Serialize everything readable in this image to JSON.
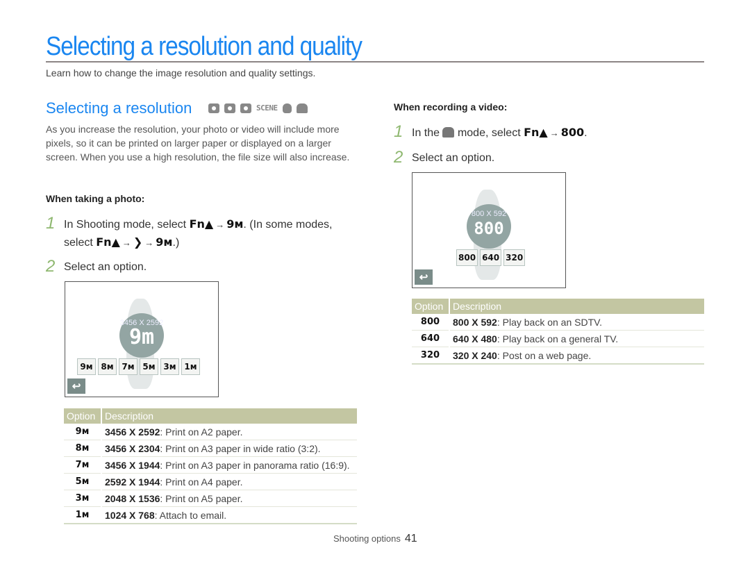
{
  "page": {
    "title": "Selecting a resolution and quality",
    "subtitle": "Learn how to change the image resolution and quality settings.",
    "section_title": "Selecting a resolution",
    "mode_icons": [
      "smart-auto-icon",
      "camera-auto-icon",
      "program-icon",
      "SCENE",
      "dual-is-icon",
      "movie-icon"
    ],
    "intro": "As you increase the resolution, your photo or video will include more pixels, so it can be printed on larger paper or displayed on a larger screen. When you use a high resolution, the file size will also increase."
  },
  "photo": {
    "heading": "When taking a photo:",
    "step1": {
      "num": "1",
      "text_a": "In Shooting mode, select",
      "key_fn": "Fn▲",
      "arrow": "→",
      "key_res": "9м",
      "text_b": ". (In some modes,",
      "text_c": "select",
      "key_next": "❯",
      "text_d": ".)"
    },
    "step2": {
      "num": "2",
      "text": "Select an option."
    },
    "screen": {
      "resolution_label": "3456 X 2592",
      "big_label": "9m",
      "options": [
        "9м",
        "8м",
        "7м",
        "5м",
        "3м",
        "1м"
      ],
      "back_label": "↩"
    },
    "table": {
      "headers": [
        "Option",
        "Description"
      ],
      "rows": [
        {
          "option": "9м",
          "res": "3456 X 2592",
          "desc": ": Print on A2 paper."
        },
        {
          "option": "8м",
          "res": "3456 X 2304",
          "desc": ": Print on A3 paper in wide ratio (3:2)."
        },
        {
          "option": "7м",
          "res": "3456 X 1944",
          "desc": ": Print on A3 paper in panorama ratio (16:9)."
        },
        {
          "option": "5м",
          "res": "2592 X 1944",
          "desc": ": Print on A4 paper."
        },
        {
          "option": "3м",
          "res": "2048 X 1536",
          "desc": ": Print on A5 paper."
        },
        {
          "option": "1м",
          "res": "1024 X 768",
          "desc": ": Attach to email."
        }
      ]
    }
  },
  "video": {
    "heading": "When recording a video:",
    "step1": {
      "num": "1",
      "text_a": "In the",
      "text_b": "mode, select",
      "key_fn": "Fn▲",
      "arrow": "→",
      "key_res": "800",
      "text_c": "."
    },
    "step2": {
      "num": "2",
      "text": "Select an option."
    },
    "screen": {
      "resolution_label": "800 X 592",
      "big_label": "800",
      "options": [
        "800",
        "640",
        "320"
      ],
      "back_label": "↩"
    },
    "table": {
      "headers": [
        "Option",
        "Description"
      ],
      "rows": [
        {
          "option": "800",
          "res": "800 X 592",
          "desc": ": Play back on an SDTV."
        },
        {
          "option": "640",
          "res": "640 X 480",
          "desc": ": Play back on a general TV."
        },
        {
          "option": "320",
          "res": "320 X 240",
          "desc": ": Post on a web page."
        }
      ]
    }
  },
  "footer": {
    "section": "Shooting options",
    "page_number": "41"
  }
}
